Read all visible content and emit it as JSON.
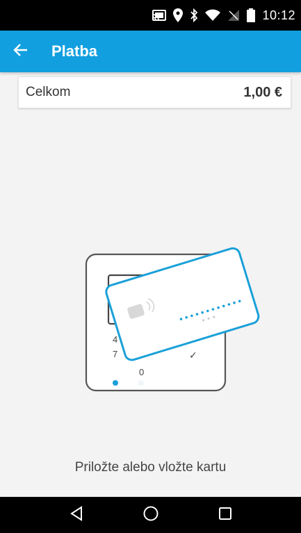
{
  "status_bar": {
    "time": "10:12",
    "icons": [
      "cast-icon",
      "location-icon",
      "bluetooth-icon",
      "wifi-icon",
      "no-signal-icon",
      "battery-icon"
    ]
  },
  "app_bar": {
    "title": "Platba",
    "back_icon": "arrow-back-icon",
    "background": "#129fdf"
  },
  "total": {
    "label": "Celkom",
    "amount": "1,00 €"
  },
  "illustration": {
    "keypad_digits": [
      "4",
      "7",
      "0"
    ],
    "confirm_symbol": "✓",
    "accent_color": "#1aa0d8"
  },
  "instruction": "Priložte alebo vložte kartu",
  "nav_bar": {
    "icons": [
      "back-triangle-icon",
      "home-circle-icon",
      "recents-square-icon"
    ]
  }
}
